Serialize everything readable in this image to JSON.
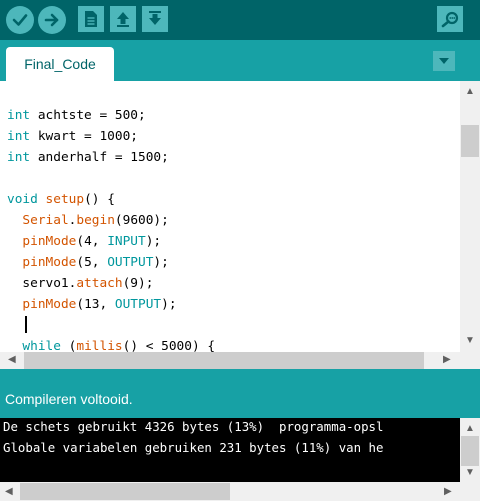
{
  "toolbar": {
    "buttons": [
      {
        "name": "verify",
        "icon": "check-icon"
      },
      {
        "name": "upload",
        "icon": "arrow-right-icon"
      },
      {
        "name": "new",
        "icon": "new-file-icon"
      },
      {
        "name": "open",
        "icon": "arrow-up-icon"
      },
      {
        "name": "save",
        "icon": "arrow-down-icon"
      },
      {
        "name": "serial-monitor",
        "icon": "magnifier-icon"
      }
    ]
  },
  "tabs": [
    {
      "label": "Final_Code"
    }
  ],
  "tab_menu_icon": "triangle-down-icon",
  "editor": {
    "lines": [
      [
        [
          "type",
          "int"
        ],
        [
          "plain",
          " achtste = 500;"
        ]
      ],
      [
        [
          "type",
          "int"
        ],
        [
          "plain",
          " kwart = 1000;"
        ]
      ],
      [
        [
          "type",
          "int"
        ],
        [
          "plain",
          " anderhalf = 1500;"
        ]
      ],
      [],
      [
        [
          "type",
          "void"
        ],
        [
          "plain",
          " "
        ],
        [
          "fn",
          "setup"
        ],
        [
          "plain",
          "() {"
        ]
      ],
      [
        [
          "plain",
          "  "
        ],
        [
          "fn",
          "Serial"
        ],
        [
          "plain",
          "."
        ],
        [
          "fn",
          "begin"
        ],
        [
          "plain",
          "(9600);"
        ]
      ],
      [
        [
          "plain",
          "  "
        ],
        [
          "fn",
          "pinMode"
        ],
        [
          "plain",
          "(4, "
        ],
        [
          "const",
          "INPUT"
        ],
        [
          "plain",
          ");"
        ]
      ],
      [
        [
          "plain",
          "  "
        ],
        [
          "fn",
          "pinMode"
        ],
        [
          "plain",
          "(5, "
        ],
        [
          "const",
          "OUTPUT"
        ],
        [
          "plain",
          ");"
        ]
      ],
      [
        [
          "plain",
          "  servo1."
        ],
        [
          "fn",
          "attach"
        ],
        [
          "plain",
          "(9);"
        ]
      ],
      [
        [
          "plain",
          "  "
        ],
        [
          "fn",
          "pinMode"
        ],
        [
          "plain",
          "(13, "
        ],
        [
          "const",
          "OUTPUT"
        ],
        [
          "plain",
          ");"
        ]
      ],
      [
        [
          "plain",
          "  "
        ]
      ],
      [
        [
          "plain",
          "  "
        ],
        [
          "type",
          "while"
        ],
        [
          "plain",
          " ("
        ],
        [
          "fn",
          "millis"
        ],
        [
          "plain",
          "() < 5000) {"
        ]
      ]
    ]
  },
  "status": {
    "text": "Compileren voltooid."
  },
  "console": {
    "lines": [
      "De schets gebruikt 4326 bytes (13%)  programma-opsl",
      "Globale variabelen gebruiken 231 bytes (11%) van he"
    ]
  },
  "colors": {
    "toolbar_bg": "#006468",
    "tabbar_bg": "#17a1a5",
    "button_bg": "#4db7bb",
    "keyword_type": "#00979d",
    "keyword_fn": "#d35400",
    "console_bg": "#000000"
  }
}
